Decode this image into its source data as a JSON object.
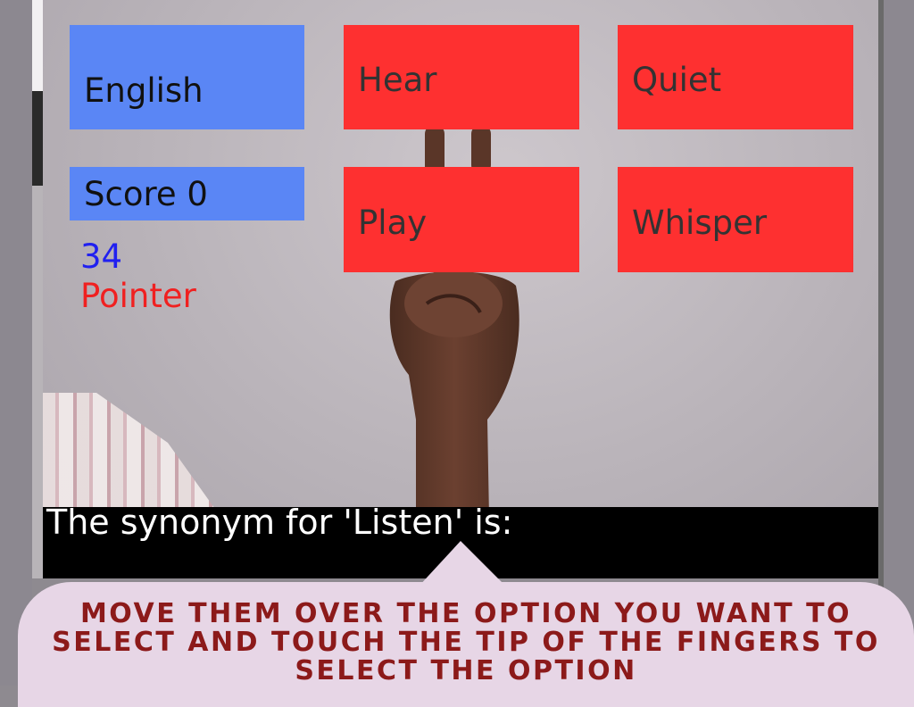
{
  "game": {
    "language_label": "English",
    "score_label": "Score 0",
    "counter": "34",
    "mode_label": "Pointer",
    "options": [
      "Hear",
      "Quiet",
      "Play",
      "Whisper"
    ],
    "question": "The synonym for 'Listen' is:"
  },
  "tutorial": {
    "instruction": "MOVE THEM OVER THE OPTION YOU WANT TO SELECT AND TOUCH THE TIP OF THE FINGERS TO SELECT THE OPTION"
  },
  "colors": {
    "panel_blue": "#5a86f5",
    "option_red": "#fe3030",
    "counter_blue": "#2020f0",
    "mode_red": "#f02020",
    "instruction_text": "#8c1a1a",
    "bubble_bg": "#e7d6e6"
  }
}
